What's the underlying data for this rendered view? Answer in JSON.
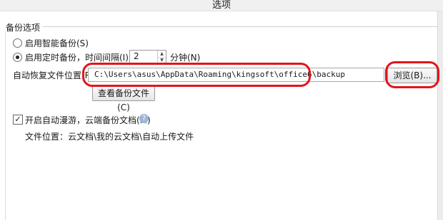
{
  "window": {
    "title": "选项"
  },
  "backup_group": {
    "label": "备份选项",
    "smart_backup_label": "启用智能备份(S)",
    "timed_backup_label": "启用定时备份，时间间隔(I):",
    "interval_value": "2",
    "interval_unit": "分钟(N)",
    "auto_recover_label": "自动恢复文件位置(R):",
    "path_value": "C:\\Users\\asus\\AppData\\Roaming\\kingsoft\\office6\\backup",
    "browse_button": "浏览(B)...",
    "view_button": "查看备份文件(C)"
  },
  "cloud": {
    "roaming_label": "开启自动漫游，云端备份文档(M)",
    "location_text": "文件位置：云文档\\我的云文档\\自动上传文件",
    "checked_mark": "✓",
    "help_mark": "?"
  }
}
